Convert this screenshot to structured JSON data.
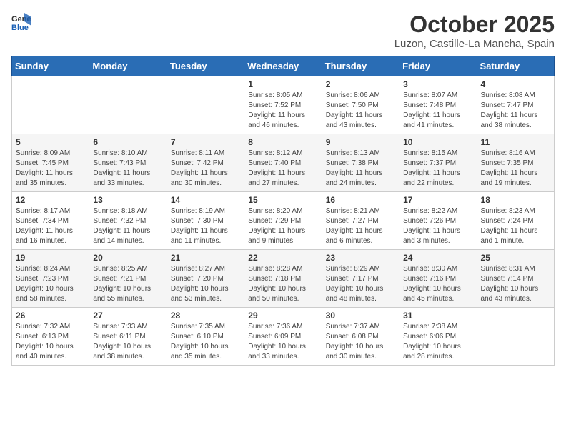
{
  "header": {
    "logo_general": "General",
    "logo_blue": "Blue",
    "month": "October 2025",
    "location": "Luzon, Castille-La Mancha, Spain"
  },
  "weekdays": [
    "Sunday",
    "Monday",
    "Tuesday",
    "Wednesday",
    "Thursday",
    "Friday",
    "Saturday"
  ],
  "weeks": [
    [
      {
        "day": "",
        "info": ""
      },
      {
        "day": "",
        "info": ""
      },
      {
        "day": "",
        "info": ""
      },
      {
        "day": "1",
        "info": "Sunrise: 8:05 AM\nSunset: 7:52 PM\nDaylight: 11 hours and 46 minutes."
      },
      {
        "day": "2",
        "info": "Sunrise: 8:06 AM\nSunset: 7:50 PM\nDaylight: 11 hours and 43 minutes."
      },
      {
        "day": "3",
        "info": "Sunrise: 8:07 AM\nSunset: 7:48 PM\nDaylight: 11 hours and 41 minutes."
      },
      {
        "day": "4",
        "info": "Sunrise: 8:08 AM\nSunset: 7:47 PM\nDaylight: 11 hours and 38 minutes."
      }
    ],
    [
      {
        "day": "5",
        "info": "Sunrise: 8:09 AM\nSunset: 7:45 PM\nDaylight: 11 hours and 35 minutes."
      },
      {
        "day": "6",
        "info": "Sunrise: 8:10 AM\nSunset: 7:43 PM\nDaylight: 11 hours and 33 minutes."
      },
      {
        "day": "7",
        "info": "Sunrise: 8:11 AM\nSunset: 7:42 PM\nDaylight: 11 hours and 30 minutes."
      },
      {
        "day": "8",
        "info": "Sunrise: 8:12 AM\nSunset: 7:40 PM\nDaylight: 11 hours and 27 minutes."
      },
      {
        "day": "9",
        "info": "Sunrise: 8:13 AM\nSunset: 7:38 PM\nDaylight: 11 hours and 24 minutes."
      },
      {
        "day": "10",
        "info": "Sunrise: 8:15 AM\nSunset: 7:37 PM\nDaylight: 11 hours and 22 minutes."
      },
      {
        "day": "11",
        "info": "Sunrise: 8:16 AM\nSunset: 7:35 PM\nDaylight: 11 hours and 19 minutes."
      }
    ],
    [
      {
        "day": "12",
        "info": "Sunrise: 8:17 AM\nSunset: 7:34 PM\nDaylight: 11 hours and 16 minutes."
      },
      {
        "day": "13",
        "info": "Sunrise: 8:18 AM\nSunset: 7:32 PM\nDaylight: 11 hours and 14 minutes."
      },
      {
        "day": "14",
        "info": "Sunrise: 8:19 AM\nSunset: 7:30 PM\nDaylight: 11 hours and 11 minutes."
      },
      {
        "day": "15",
        "info": "Sunrise: 8:20 AM\nSunset: 7:29 PM\nDaylight: 11 hours and 9 minutes."
      },
      {
        "day": "16",
        "info": "Sunrise: 8:21 AM\nSunset: 7:27 PM\nDaylight: 11 hours and 6 minutes."
      },
      {
        "day": "17",
        "info": "Sunrise: 8:22 AM\nSunset: 7:26 PM\nDaylight: 11 hours and 3 minutes."
      },
      {
        "day": "18",
        "info": "Sunrise: 8:23 AM\nSunset: 7:24 PM\nDaylight: 11 hours and 1 minute."
      }
    ],
    [
      {
        "day": "19",
        "info": "Sunrise: 8:24 AM\nSunset: 7:23 PM\nDaylight: 10 hours and 58 minutes."
      },
      {
        "day": "20",
        "info": "Sunrise: 8:25 AM\nSunset: 7:21 PM\nDaylight: 10 hours and 55 minutes."
      },
      {
        "day": "21",
        "info": "Sunrise: 8:27 AM\nSunset: 7:20 PM\nDaylight: 10 hours and 53 minutes."
      },
      {
        "day": "22",
        "info": "Sunrise: 8:28 AM\nSunset: 7:18 PM\nDaylight: 10 hours and 50 minutes."
      },
      {
        "day": "23",
        "info": "Sunrise: 8:29 AM\nSunset: 7:17 PM\nDaylight: 10 hours and 48 minutes."
      },
      {
        "day": "24",
        "info": "Sunrise: 8:30 AM\nSunset: 7:16 PM\nDaylight: 10 hours and 45 minutes."
      },
      {
        "day": "25",
        "info": "Sunrise: 8:31 AM\nSunset: 7:14 PM\nDaylight: 10 hours and 43 minutes."
      }
    ],
    [
      {
        "day": "26",
        "info": "Sunrise: 7:32 AM\nSunset: 6:13 PM\nDaylight: 10 hours and 40 minutes."
      },
      {
        "day": "27",
        "info": "Sunrise: 7:33 AM\nSunset: 6:11 PM\nDaylight: 10 hours and 38 minutes."
      },
      {
        "day": "28",
        "info": "Sunrise: 7:35 AM\nSunset: 6:10 PM\nDaylight: 10 hours and 35 minutes."
      },
      {
        "day": "29",
        "info": "Sunrise: 7:36 AM\nSunset: 6:09 PM\nDaylight: 10 hours and 33 minutes."
      },
      {
        "day": "30",
        "info": "Sunrise: 7:37 AM\nSunset: 6:08 PM\nDaylight: 10 hours and 30 minutes."
      },
      {
        "day": "31",
        "info": "Sunrise: 7:38 AM\nSunset: 6:06 PM\nDaylight: 10 hours and 28 minutes."
      },
      {
        "day": "",
        "info": ""
      }
    ]
  ]
}
